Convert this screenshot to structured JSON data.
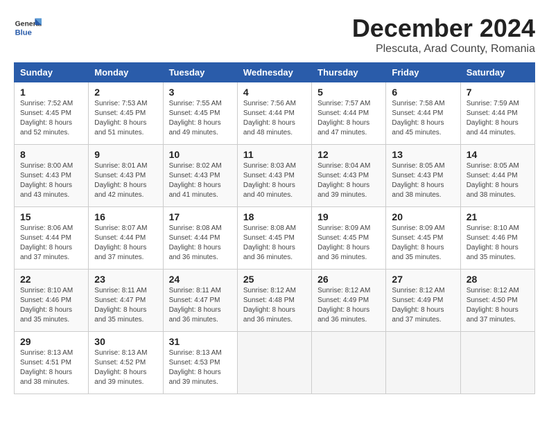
{
  "header": {
    "logo_general": "General",
    "logo_blue": "Blue",
    "month_title": "December 2024",
    "location": "Plescuta, Arad County, Romania"
  },
  "calendar": {
    "days_of_week": [
      "Sunday",
      "Monday",
      "Tuesday",
      "Wednesday",
      "Thursday",
      "Friday",
      "Saturday"
    ],
    "weeks": [
      [
        {
          "day": "1",
          "info": "Sunrise: 7:52 AM\nSunset: 4:45 PM\nDaylight: 8 hours\nand 52 minutes."
        },
        {
          "day": "2",
          "info": "Sunrise: 7:53 AM\nSunset: 4:45 PM\nDaylight: 8 hours\nand 51 minutes."
        },
        {
          "day": "3",
          "info": "Sunrise: 7:55 AM\nSunset: 4:45 PM\nDaylight: 8 hours\nand 49 minutes."
        },
        {
          "day": "4",
          "info": "Sunrise: 7:56 AM\nSunset: 4:44 PM\nDaylight: 8 hours\nand 48 minutes."
        },
        {
          "day": "5",
          "info": "Sunrise: 7:57 AM\nSunset: 4:44 PM\nDaylight: 8 hours\nand 47 minutes."
        },
        {
          "day": "6",
          "info": "Sunrise: 7:58 AM\nSunset: 4:44 PM\nDaylight: 8 hours\nand 45 minutes."
        },
        {
          "day": "7",
          "info": "Sunrise: 7:59 AM\nSunset: 4:44 PM\nDaylight: 8 hours\nand 44 minutes."
        }
      ],
      [
        {
          "day": "8",
          "info": "Sunrise: 8:00 AM\nSunset: 4:43 PM\nDaylight: 8 hours\nand 43 minutes."
        },
        {
          "day": "9",
          "info": "Sunrise: 8:01 AM\nSunset: 4:43 PM\nDaylight: 8 hours\nand 42 minutes."
        },
        {
          "day": "10",
          "info": "Sunrise: 8:02 AM\nSunset: 4:43 PM\nDaylight: 8 hours\nand 41 minutes."
        },
        {
          "day": "11",
          "info": "Sunrise: 8:03 AM\nSunset: 4:43 PM\nDaylight: 8 hours\nand 40 minutes."
        },
        {
          "day": "12",
          "info": "Sunrise: 8:04 AM\nSunset: 4:43 PM\nDaylight: 8 hours\nand 39 minutes."
        },
        {
          "day": "13",
          "info": "Sunrise: 8:05 AM\nSunset: 4:43 PM\nDaylight: 8 hours\nand 38 minutes."
        },
        {
          "day": "14",
          "info": "Sunrise: 8:05 AM\nSunset: 4:44 PM\nDaylight: 8 hours\nand 38 minutes."
        }
      ],
      [
        {
          "day": "15",
          "info": "Sunrise: 8:06 AM\nSunset: 4:44 PM\nDaylight: 8 hours\nand 37 minutes."
        },
        {
          "day": "16",
          "info": "Sunrise: 8:07 AM\nSunset: 4:44 PM\nDaylight: 8 hours\nand 37 minutes."
        },
        {
          "day": "17",
          "info": "Sunrise: 8:08 AM\nSunset: 4:44 PM\nDaylight: 8 hours\nand 36 minutes."
        },
        {
          "day": "18",
          "info": "Sunrise: 8:08 AM\nSunset: 4:45 PM\nDaylight: 8 hours\nand 36 minutes."
        },
        {
          "day": "19",
          "info": "Sunrise: 8:09 AM\nSunset: 4:45 PM\nDaylight: 8 hours\nand 36 minutes."
        },
        {
          "day": "20",
          "info": "Sunrise: 8:09 AM\nSunset: 4:45 PM\nDaylight: 8 hours\nand 35 minutes."
        },
        {
          "day": "21",
          "info": "Sunrise: 8:10 AM\nSunset: 4:46 PM\nDaylight: 8 hours\nand 35 minutes."
        }
      ],
      [
        {
          "day": "22",
          "info": "Sunrise: 8:10 AM\nSunset: 4:46 PM\nDaylight: 8 hours\nand 35 minutes."
        },
        {
          "day": "23",
          "info": "Sunrise: 8:11 AM\nSunset: 4:47 PM\nDaylight: 8 hours\nand 35 minutes."
        },
        {
          "day": "24",
          "info": "Sunrise: 8:11 AM\nSunset: 4:47 PM\nDaylight: 8 hours\nand 36 minutes."
        },
        {
          "day": "25",
          "info": "Sunrise: 8:12 AM\nSunset: 4:48 PM\nDaylight: 8 hours\nand 36 minutes."
        },
        {
          "day": "26",
          "info": "Sunrise: 8:12 AM\nSunset: 4:49 PM\nDaylight: 8 hours\nand 36 minutes."
        },
        {
          "day": "27",
          "info": "Sunrise: 8:12 AM\nSunset: 4:49 PM\nDaylight: 8 hours\nand 37 minutes."
        },
        {
          "day": "28",
          "info": "Sunrise: 8:12 AM\nSunset: 4:50 PM\nDaylight: 8 hours\nand 37 minutes."
        }
      ],
      [
        {
          "day": "29",
          "info": "Sunrise: 8:13 AM\nSunset: 4:51 PM\nDaylight: 8 hours\nand 38 minutes."
        },
        {
          "day": "30",
          "info": "Sunrise: 8:13 AM\nSunset: 4:52 PM\nDaylight: 8 hours\nand 39 minutes."
        },
        {
          "day": "31",
          "info": "Sunrise: 8:13 AM\nSunset: 4:53 PM\nDaylight: 8 hours\nand 39 minutes."
        },
        null,
        null,
        null,
        null
      ]
    ]
  }
}
